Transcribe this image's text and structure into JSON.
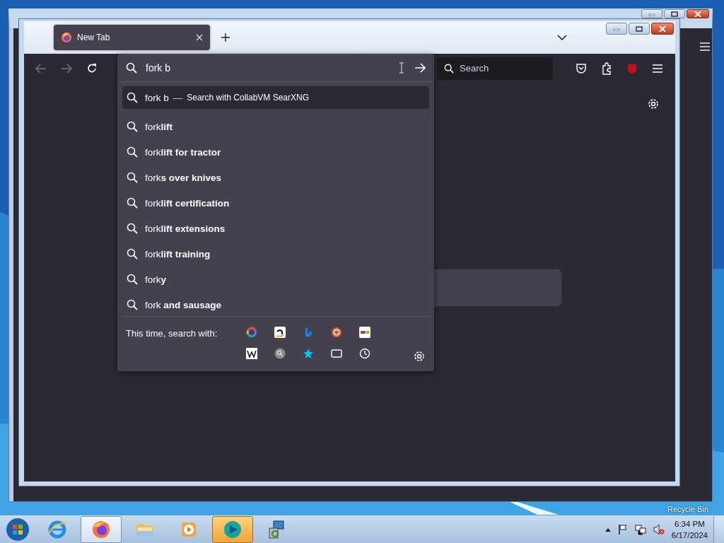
{
  "desktop": {
    "icon_label": "Recycle Bin"
  },
  "browser": {
    "tabs": [
      {
        "label": "New Tab",
        "selected": true
      }
    ],
    "address_bar": {
      "value": "fork b"
    },
    "search_bar": {
      "placeholder": "Search"
    },
    "dropdown": {
      "heading": {
        "query": "fork b",
        "separator": "—",
        "action": "Search with CollabVM SearXNG",
        "selected": true
      },
      "suggestions": [
        {
          "text": "fork**lift**",
          "selected": false
        },
        {
          "text": "fork**lift for tractor**",
          "selected": false
        },
        {
          "text": "fork**s over knives**",
          "selected": false
        },
        {
          "text": "fork**lift certification**",
          "selected": false
        },
        {
          "text": "fork**lift extensions**",
          "selected": false
        },
        {
          "text": "fork**lift training**",
          "selected": false
        },
        {
          "text": "fork**y**",
          "selected": false
        },
        {
          "text": "fork **and sausage**",
          "selected": false
        }
      ],
      "one_off_label": "This time, search with:",
      "one_offs": [
        {
          "kind": "google"
        },
        {
          "kind": "amazon"
        },
        {
          "kind": "bing"
        },
        {
          "kind": "duck"
        },
        {
          "kind": "ebay"
        },
        {
          "kind": "wiki"
        },
        {
          "kind": "gray"
        },
        {
          "kind": "star"
        },
        {
          "kind": "tabs"
        },
        {
          "kind": "history"
        }
      ]
    }
  },
  "taskbar": {
    "items": [
      {
        "kind": "ie",
        "selected": false
      },
      {
        "kind": "firefox",
        "selected": true
      },
      {
        "kind": "folder",
        "selected": false
      },
      {
        "kind": "media",
        "selected": false
      },
      {
        "kind": "collab",
        "selected": true
      },
      {
        "kind": "setup",
        "selected": false
      }
    ],
    "clock": {
      "time": "6:34 PM",
      "date": "6/17/2024"
    }
  }
}
